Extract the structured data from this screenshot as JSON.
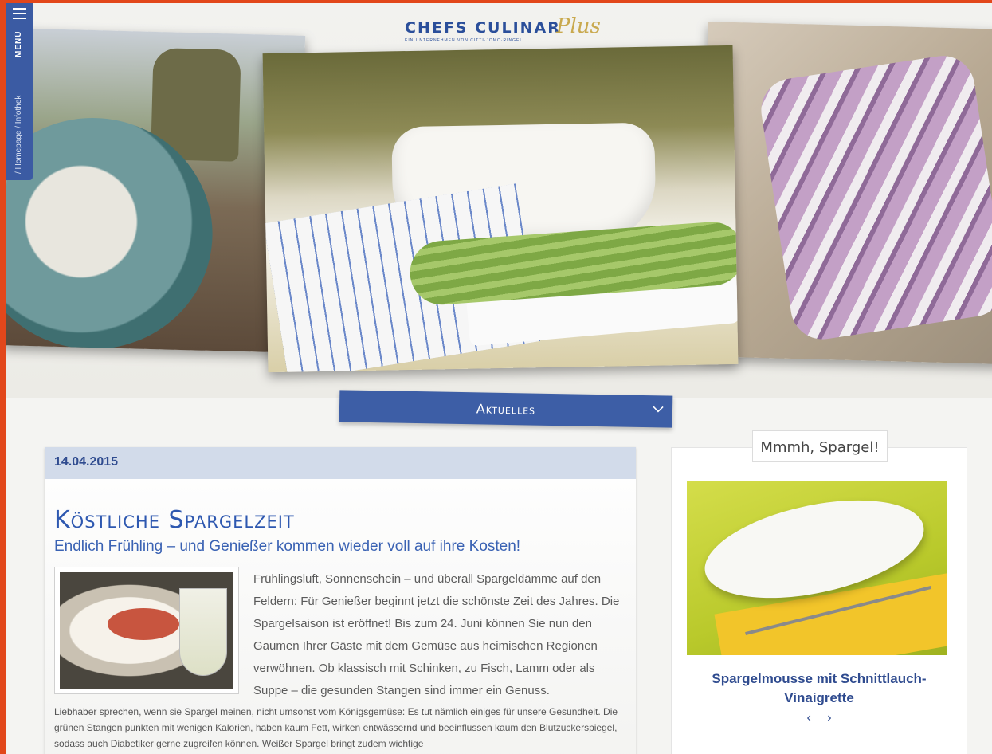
{
  "logo": {
    "main": "CHEFS CULINAR",
    "plus": "Plus",
    "sub": "EIN UNTERNEHMEN VON CITTI·JOMO·RINGEL"
  },
  "side_menu": {
    "label": "MENÜ",
    "breadcrumb": "/ Homepage / Infothek"
  },
  "section": {
    "label": "Aktuelles"
  },
  "article": {
    "date": "14.04.2015",
    "title": "Köstliche Spargelzeit",
    "subtitle": "Endlich Frühling – und Genießer kommen wieder voll auf ihre Kosten!",
    "lead": "Frühlingsluft, Sonnenschein – und überall Spargeldämme auf den Feldern: Für Genießer beginnt jetzt die schönste Zeit des Jahres. Die Spargelsaison ist eröffnet! Bis zum 24. Juni können Sie nun den Gaumen Ihrer Gäste mit dem Gemüse aus heimischen Regionen verwöhnen. Ob klassisch mit Schinken, zu Fisch, Lamm oder als Suppe – die gesunden Stangen sind immer ein Genuss.",
    "body": "Liebhaber sprechen, wenn sie Spargel meinen, nicht umsonst vom Königsgemüse: Es tut nämlich einiges für unsere Gesundheit. Die grünen Stangen punkten mit wenigen Kalorien, haben kaum Fett, wirken entwässernd und beeinflussen kaum den Blutzuckerspiegel, sodass auch Diabetiker gerne zugreifen können. Weißer Spargel bringt zudem wichtige"
  },
  "teaser": {
    "tag": "Mmmh, Spargel!",
    "caption": "Spargelmousse mit Schnittlauch-Vinaigrette",
    "prev": "‹",
    "next": "›"
  },
  "colors": {
    "frame": "#e2471b",
    "brand_blue": "#3b5ba3",
    "date_bar": "#d2dbea",
    "title_blue": "#2e58b0"
  }
}
